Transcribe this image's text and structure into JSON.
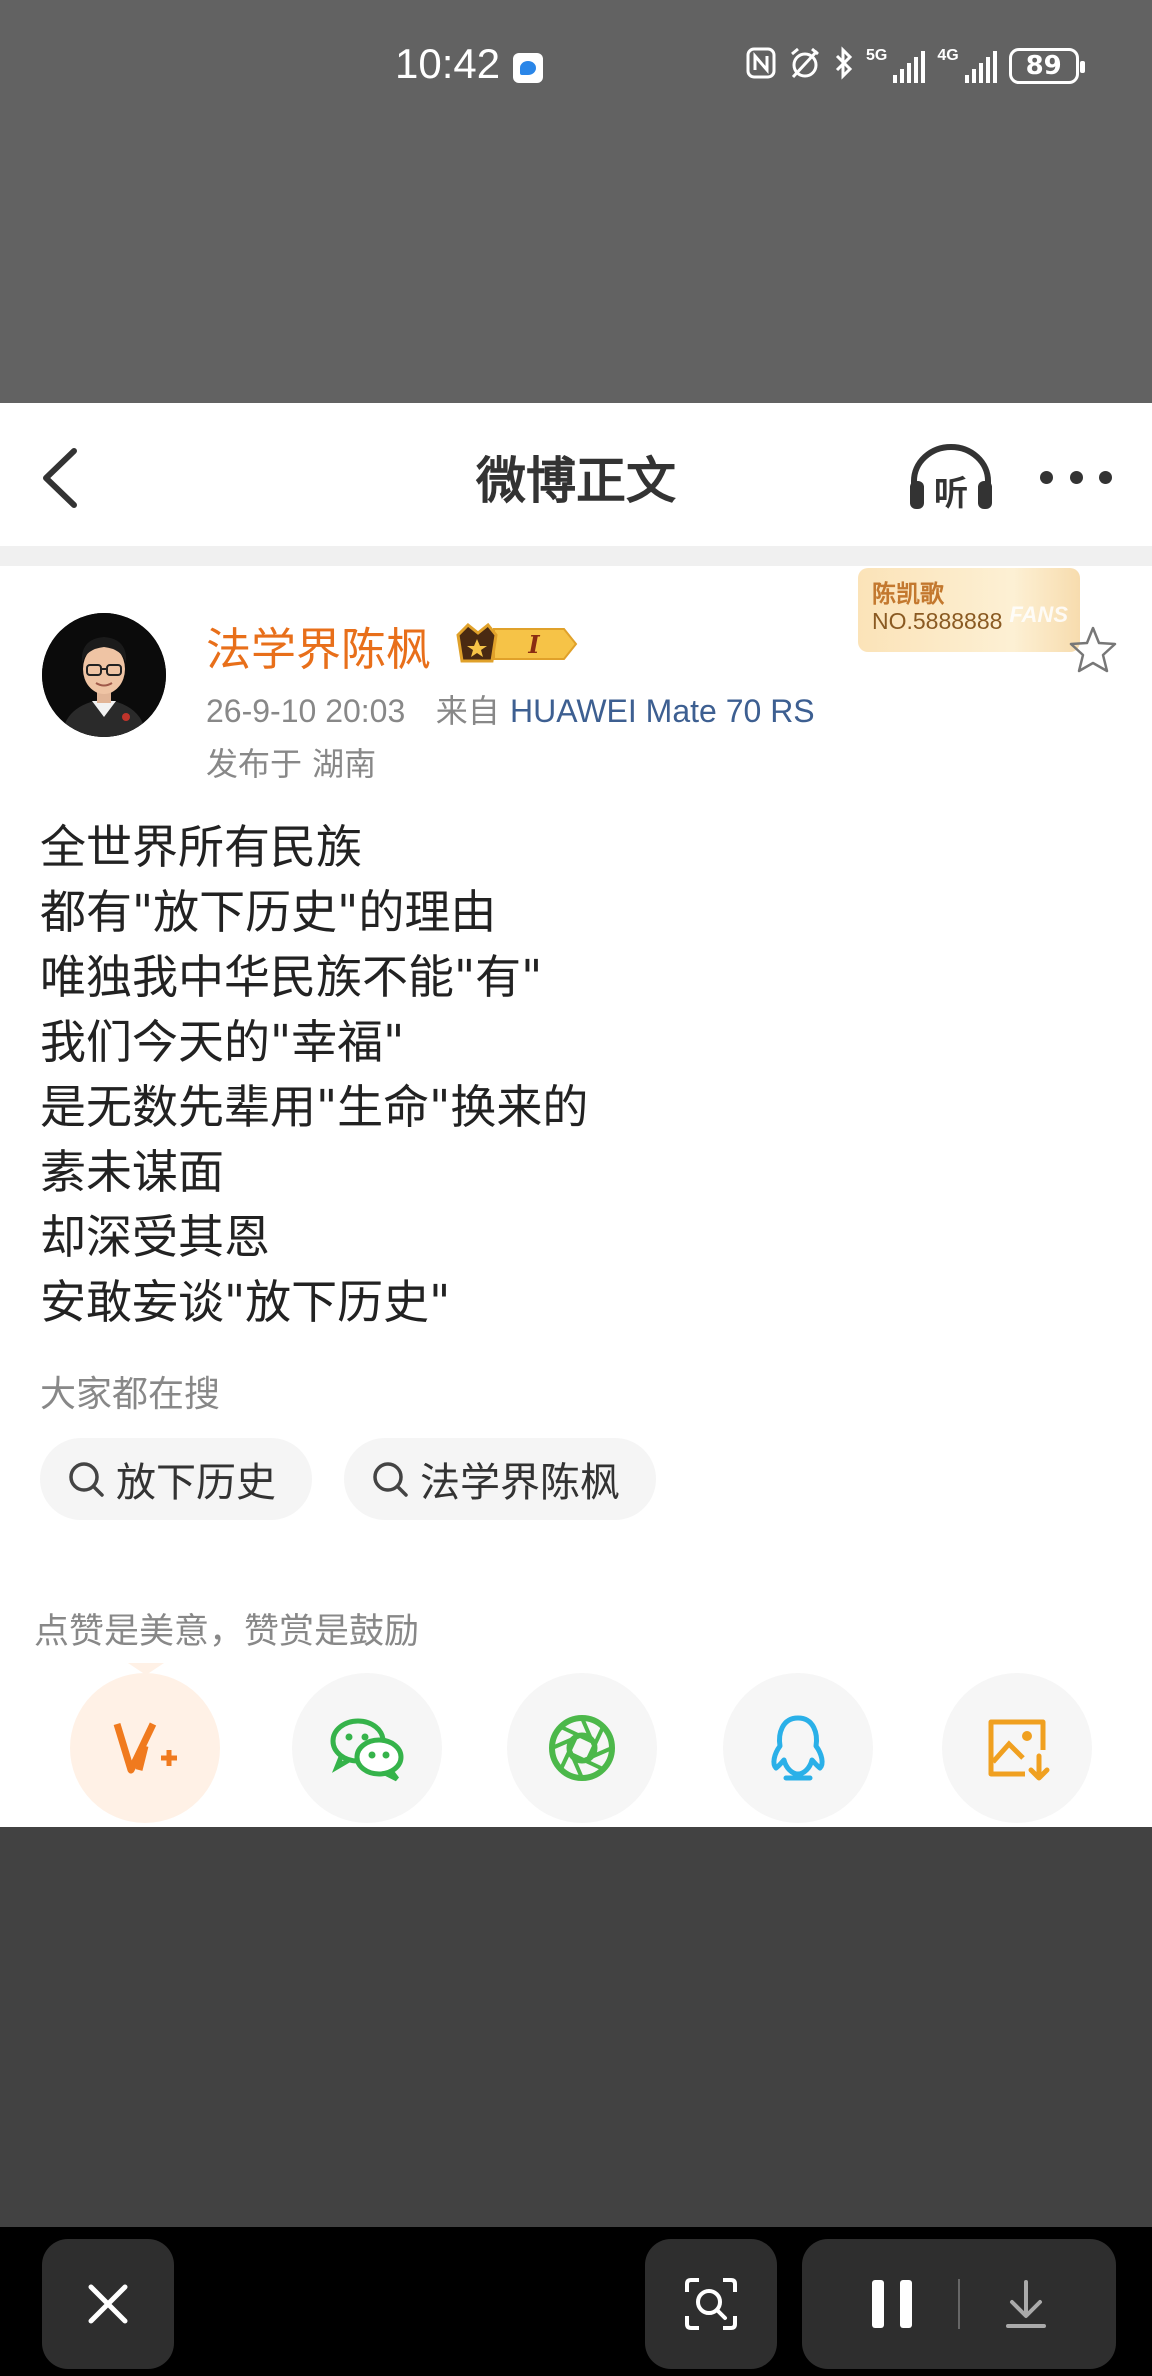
{
  "status_bar": {
    "time": "10:42",
    "network_1": "5G",
    "network_2": "4G",
    "battery": "89"
  },
  "nav": {
    "title": "微博正文",
    "listen_label": "听"
  },
  "post": {
    "username": "法学界陈枫",
    "vip_level": "I",
    "fans_badge": {
      "name": "陈凯歌",
      "number": "NO.5888888",
      "text": "FANS"
    },
    "time": "26-9-10 20:03",
    "source_prefix": "来自",
    "device": "HUAWEI Mate 70 RS",
    "location": "发布于 湖南",
    "lines": [
      "全世界所有民族",
      "都有\"放下历史\"的理由",
      "唯独我中华民族不能\"有\"",
      "我们今天的\"幸福\"",
      "是无数先辈用\"生命\"换来的",
      "素未谋面",
      "却深受其恩",
      "安敢妄谈\"放下历史\""
    ]
  },
  "search": {
    "label": "大家都在搜",
    "chips": [
      "放下历史",
      "法学界陈枫"
    ]
  },
  "reward": {
    "tip": "点赞是美意，赞赏是鼓励"
  },
  "share_icons": [
    "v-plus-icon",
    "wechat-icon",
    "moments-icon",
    "qq-icon",
    "save-image-icon"
  ],
  "colors": {
    "accent": "#e86f1a",
    "link": "#3d5f91",
    "wechat": "#35b34a",
    "qq": "#2ab0e8",
    "gold": "#f0a020"
  }
}
